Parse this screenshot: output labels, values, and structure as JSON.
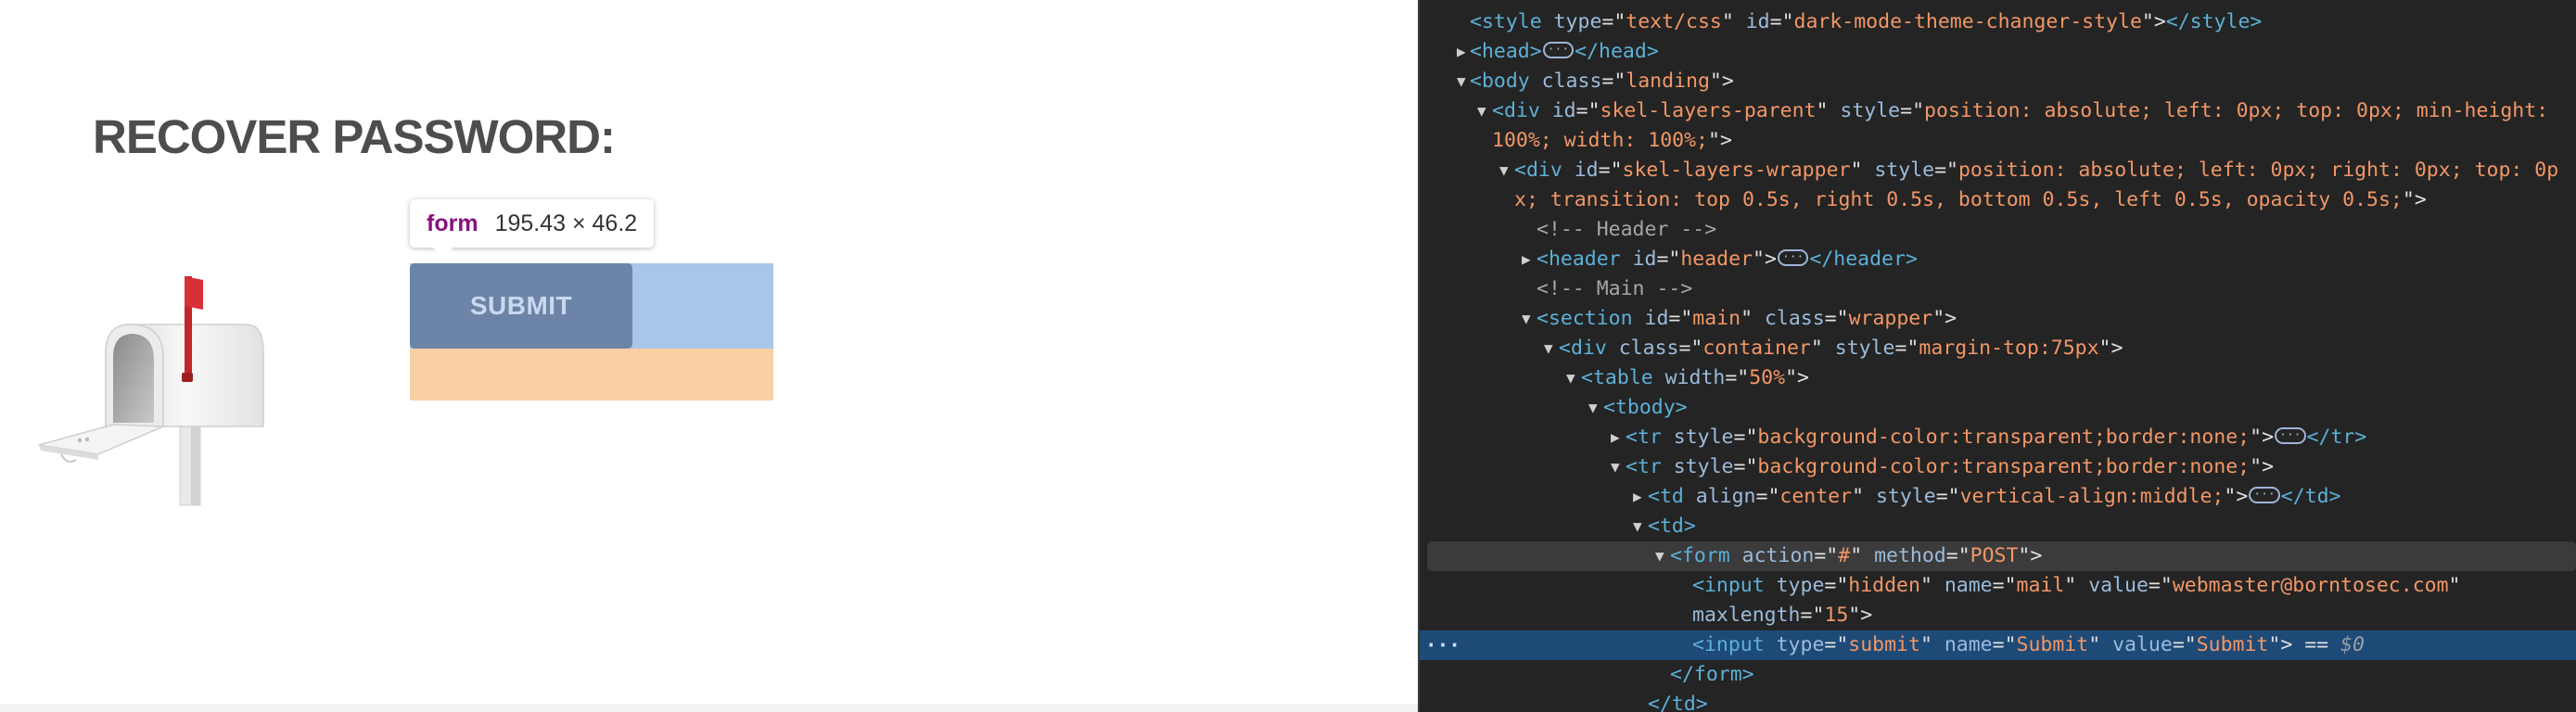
{
  "page": {
    "title": "RECOVER PASSWORD:",
    "submit_label": "SUBMIT"
  },
  "tooltip": {
    "tag": "form",
    "size": "195.43 × 46.2"
  },
  "colors": {
    "title": "#4d4d4d",
    "submit_bg": "#6c84a7",
    "highlight_content": "#6fa0d9",
    "highlight_margin": "#f6b26b",
    "devtools_bg": "#242424",
    "selected_row": "#1e4a78"
  },
  "devtools": {
    "lines": [
      {
        "parts": [
          [
            "t",
            "<style "
          ],
          [
            "a",
            "type"
          ],
          [
            "p",
            "=\""
          ],
          [
            "v",
            "text/css"
          ],
          [
            "p",
            "\" "
          ],
          [
            "a",
            "id"
          ],
          [
            "p",
            "=\""
          ],
          [
            "v",
            "dark-mode-theme-changer-style"
          ],
          [
            "p",
            "\">"
          ],
          [
            "t",
            "</style>"
          ]
        ]
      },
      {
        "parts": [
          [
            "t",
            "<head>"
          ],
          [
            "badge",
            "···"
          ],
          [
            "t",
            "</head>"
          ]
        ]
      },
      {
        "parts": [
          [
            "t",
            "<body "
          ],
          [
            "a",
            "class"
          ],
          [
            "p",
            "=\""
          ],
          [
            "v",
            "landing"
          ],
          [
            "p",
            "\">"
          ]
        ]
      },
      {
        "parts": [
          [
            "t",
            "<div "
          ],
          [
            "a",
            "id"
          ],
          [
            "p",
            "=\""
          ],
          [
            "v",
            "skel-layers-parent"
          ],
          [
            "p",
            "\" "
          ],
          [
            "a",
            "style"
          ],
          [
            "p",
            "=\""
          ],
          [
            "v",
            "position: absolute; left: 0px; top: 0px; min-height:"
          ]
        ]
      },
      {
        "parts": [
          [
            "v",
            "100%; width: 100%;"
          ],
          [
            "p",
            "\">"
          ]
        ]
      },
      {
        "parts": [
          [
            "t",
            "<div "
          ],
          [
            "a",
            "id"
          ],
          [
            "p",
            "=\""
          ],
          [
            "v",
            "skel-layers-wrapper"
          ],
          [
            "p",
            "\" "
          ],
          [
            "a",
            "style"
          ],
          [
            "p",
            "=\""
          ],
          [
            "v",
            "position: absolute; left: 0px; right: 0px; top: 0p"
          ]
        ]
      },
      {
        "parts": [
          [
            "v",
            "x; transition: top 0.5s, right 0.5s, bottom 0.5s, left 0.5s, opacity 0.5s;"
          ],
          [
            "p",
            "\">"
          ]
        ]
      },
      {
        "parts": [
          [
            "c",
            "<!-- Header -->"
          ]
        ]
      },
      {
        "parts": [
          [
            "t",
            "<header "
          ],
          [
            "a",
            "id"
          ],
          [
            "p",
            "=\""
          ],
          [
            "v",
            "header"
          ],
          [
            "p",
            "\">"
          ],
          [
            "badge",
            "···"
          ],
          [
            "t",
            "</header>"
          ]
        ]
      },
      {
        "parts": [
          [
            "c",
            "<!-- Main -->"
          ]
        ]
      },
      {
        "parts": [
          [
            "t",
            "<section "
          ],
          [
            "a",
            "id"
          ],
          [
            "p",
            "=\""
          ],
          [
            "v",
            "main"
          ],
          [
            "p",
            "\" "
          ],
          [
            "a",
            "class"
          ],
          [
            "p",
            "=\""
          ],
          [
            "v",
            "wrapper"
          ],
          [
            "p",
            "\">"
          ]
        ]
      },
      {
        "parts": [
          [
            "t",
            "<div "
          ],
          [
            "a",
            "class"
          ],
          [
            "p",
            "=\""
          ],
          [
            "v",
            "container"
          ],
          [
            "p",
            "\" "
          ],
          [
            "a",
            "style"
          ],
          [
            "p",
            "=\""
          ],
          [
            "v",
            "margin-top:75px"
          ],
          [
            "p",
            "\">"
          ]
        ]
      },
      {
        "parts": [
          [
            "t",
            "<table "
          ],
          [
            "a",
            "width"
          ],
          [
            "p",
            "=\""
          ],
          [
            "v",
            "50%"
          ],
          [
            "p",
            "\">"
          ]
        ]
      },
      {
        "parts": [
          [
            "t",
            "<tbody>"
          ]
        ]
      },
      {
        "parts": [
          [
            "t",
            "<tr "
          ],
          [
            "a",
            "style"
          ],
          [
            "p",
            "=\""
          ],
          [
            "v",
            "background-color:transparent;border:none;"
          ],
          [
            "p",
            "\">"
          ],
          [
            "badge",
            "···"
          ],
          [
            "t",
            "</tr>"
          ]
        ]
      },
      {
        "parts": [
          [
            "t",
            "<tr "
          ],
          [
            "a",
            "style"
          ],
          [
            "p",
            "=\""
          ],
          [
            "v",
            "background-color:transparent;border:none;"
          ],
          [
            "p",
            "\">"
          ]
        ]
      },
      {
        "parts": [
          [
            "t",
            "<td "
          ],
          [
            "a",
            "align"
          ],
          [
            "p",
            "=\""
          ],
          [
            "v",
            "center"
          ],
          [
            "p",
            "\" "
          ],
          [
            "a",
            "style"
          ],
          [
            "p",
            "=\""
          ],
          [
            "v",
            "vertical-align:middle;"
          ],
          [
            "p",
            "\">"
          ],
          [
            "badge",
            "···"
          ],
          [
            "t",
            "</td>"
          ]
        ]
      },
      {
        "parts": [
          [
            "t",
            "<td>"
          ]
        ]
      },
      {
        "parts": [
          [
            "t",
            "<form "
          ],
          [
            "a",
            "action"
          ],
          [
            "p",
            "=\""
          ],
          [
            "v",
            "#"
          ],
          [
            "p",
            "\" "
          ],
          [
            "a",
            "method"
          ],
          [
            "p",
            "=\""
          ],
          [
            "v",
            "POST"
          ],
          [
            "p",
            "\">"
          ]
        ]
      },
      {
        "parts": [
          [
            "t",
            "<input "
          ],
          [
            "a",
            "type"
          ],
          [
            "p",
            "=\""
          ],
          [
            "v",
            "hidden"
          ],
          [
            "p",
            "\" "
          ],
          [
            "a",
            "name"
          ],
          [
            "p",
            "=\""
          ],
          [
            "v",
            "mail"
          ],
          [
            "p",
            "\" "
          ],
          [
            "a",
            "value"
          ],
          [
            "p",
            "=\""
          ],
          [
            "v",
            "webmaster@borntosec.com"
          ],
          [
            "p",
            "\""
          ]
        ]
      },
      {
        "parts": [
          [
            "a",
            "maxlength"
          ],
          [
            "p",
            "=\""
          ],
          [
            "v",
            "15"
          ],
          [
            "p",
            "\">"
          ]
        ]
      },
      {
        "parts": [
          [
            "t",
            "<input "
          ],
          [
            "a",
            "type"
          ],
          [
            "p",
            "=\""
          ],
          [
            "v",
            "submit"
          ],
          [
            "p",
            "\" "
          ],
          [
            "a",
            "name"
          ],
          [
            "p",
            "=\""
          ],
          [
            "v",
            "Submit"
          ],
          [
            "p",
            "\" "
          ],
          [
            "a",
            "value"
          ],
          [
            "p",
            "=\""
          ],
          [
            "v",
            "Submit"
          ],
          [
            "p",
            "\">"
          ],
          [
            "p",
            " == "
          ],
          [
            "d",
            "$0"
          ]
        ]
      },
      {
        "parts": [
          [
            "t",
            "</form>"
          ]
        ]
      },
      {
        "parts": [
          [
            "t",
            "</td>"
          ]
        ]
      }
    ],
    "gutter_marker": "···"
  }
}
